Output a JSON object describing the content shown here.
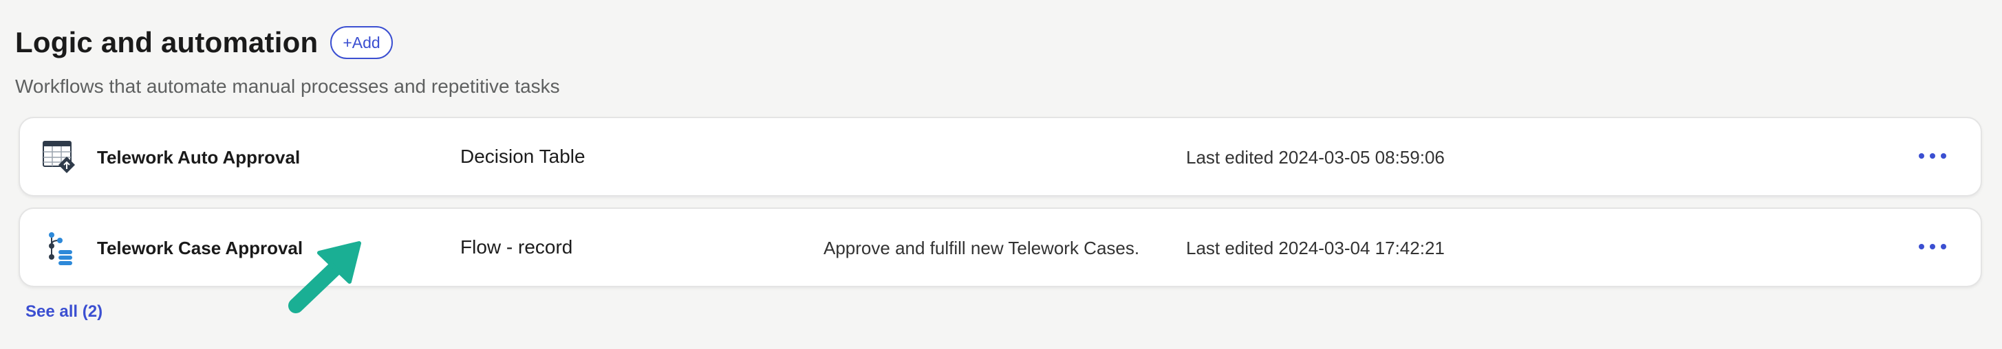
{
  "section": {
    "title": "Logic and automation",
    "add_label": "+Add",
    "subtitle": "Workflows that automate manual processes and repetitive tasks"
  },
  "items": [
    {
      "name": "Telework Auto Approval",
      "type": "Decision Table",
      "description": "",
      "edited": "Last edited 2024-03-05 08:59:06",
      "icon": "decision-table-icon"
    },
    {
      "name": "Telework Case Approval",
      "type": "Flow - record",
      "description": "Approve and fulfill new Telework Cases.",
      "edited": "Last edited 2024-03-04 17:42:21",
      "icon": "flow-icon"
    }
  ],
  "see_all_label": "See all (2)",
  "colors": {
    "accent": "#3b4fd1",
    "arrow": "#1aaf94",
    "icon_blue": "#2d89d9",
    "icon_dark": "#2f3b4a"
  }
}
